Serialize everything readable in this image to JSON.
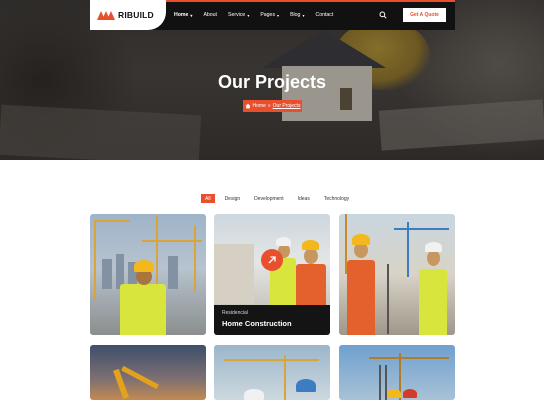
{
  "brand": {
    "name": "RIBUILD",
    "accent": "#e8502d"
  },
  "nav": {
    "items": [
      {
        "label": "Home",
        "caret": true,
        "active": true
      },
      {
        "label": "About",
        "caret": false
      },
      {
        "label": "Service",
        "caret": true
      },
      {
        "label": "Pages",
        "caret": true
      },
      {
        "label": "Blog",
        "caret": true
      },
      {
        "label": "Contact",
        "caret": false
      }
    ],
    "search_icon": "search-icon",
    "cta_label": "Get A Quote"
  },
  "hero": {
    "title": "Our Projects",
    "breadcrumb_home": "Home",
    "breadcrumb_sep": "»",
    "breadcrumb_current": "Our Projects"
  },
  "filters": [
    "All",
    "Design",
    "Development",
    "Ideas",
    "Technology"
  ],
  "projects": [
    {
      "category": "Residencial",
      "title": "Home Construction"
    }
  ]
}
